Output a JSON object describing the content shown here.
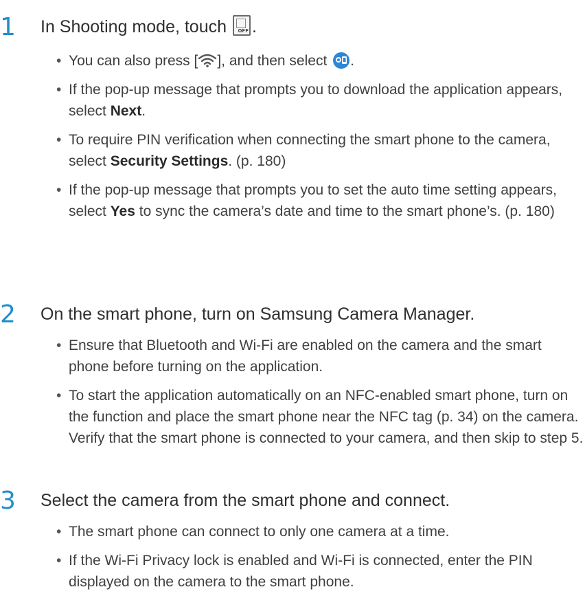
{
  "steps": [
    {
      "number": "1",
      "title_before": "In Shooting mode, touch",
      "title_after": ".",
      "icon": "camera-off-icon",
      "icon_text": "OFF",
      "bullets": [
        {
          "before": "You can also press [",
          "middle": "], and then select",
          "after": ".",
          "icons": [
            "wifi-icon",
            "camera-manager-app-icon"
          ]
        },
        {
          "text_before": "If the pop-up message that prompts you to download the application appears, select ",
          "bold": "Next",
          "text_after": "."
        },
        {
          "text_before": "To require PIN verification when connecting the smart phone to the camera, select ",
          "bold": "Security Settings",
          "text_after": ". (p. 180)"
        },
        {
          "text_before": "If the pop-up message that prompts you to set the auto time setting appears, select ",
          "bold": "Yes",
          "text_after": " to sync the camera’s date and time to the smart phone’s. (p. 180)"
        }
      ]
    },
    {
      "number": "2",
      "title": "On the smart phone, turn on Samsung Camera Manager.",
      "bullets": [
        "Ensure that Bluetooth and Wi-Fi are enabled on the camera and the smart phone before turning on the application.",
        "To start the application automatically on an NFC-enabled smart phone, turn on the function and place the smart phone near the NFC tag (p. 34) on the camera. Verify that the smart phone is connected to your camera, and then skip to step 5."
      ]
    },
    {
      "number": "3",
      "title": "Select the camera from the smart phone and connect.",
      "bullets": [
        "The smart phone can connect to only one camera at a time.",
        "If the Wi-Fi Privacy lock is enabled and Wi-Fi is connected, enter the PIN displayed on the camera to the smart phone."
      ]
    }
  ],
  "colors": {
    "step_number": "#1f8fc8",
    "text": "#404040",
    "app_icon_blue": "#2f86d6"
  }
}
